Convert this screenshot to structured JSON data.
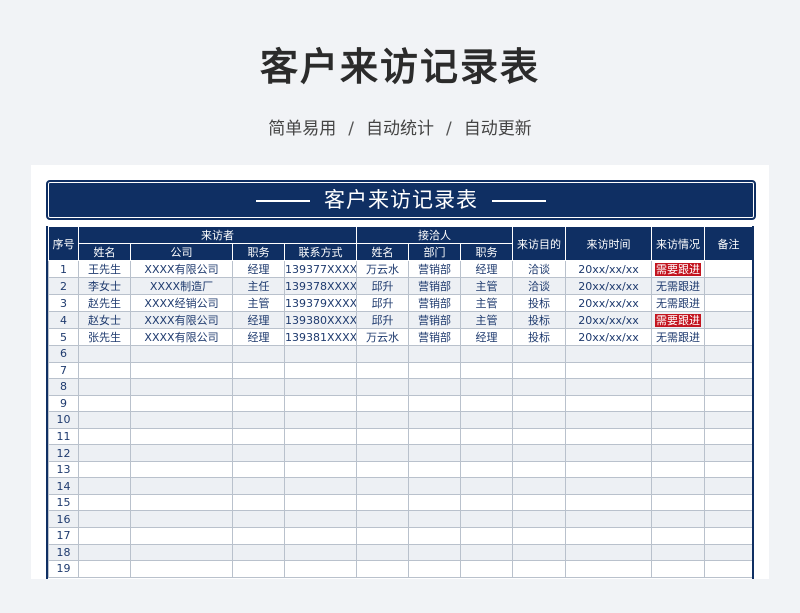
{
  "page_title": "客户来访记录表",
  "subtitle": [
    "简单易用",
    "自动统计",
    "自动更新"
  ],
  "subtitle_separator": "/",
  "banner_title": "客户来访记录表",
  "header": {
    "index": "序号",
    "visitor_group": "来访者",
    "host_group": "接洽人",
    "purpose": "来访目的",
    "time": "来访时间",
    "status": "来访情况",
    "note": "备注",
    "visitor_cols": [
      "姓名",
      "公司",
      "职务",
      "联系方式"
    ],
    "host_cols": [
      "姓名",
      "部门",
      "职务"
    ]
  },
  "colors": {
    "navy": "#0f2f63",
    "needs_followup": "#c3141f"
  },
  "rows": [
    {
      "idx": "1",
      "name": "王先生",
      "company": "XXXX有限公司",
      "title": "经理",
      "phone": "139377XXXX",
      "host": "万云水",
      "dept": "营销部",
      "host_title": "经理",
      "purpose": "洽谈",
      "time": "20xx/xx/xx",
      "status": "需要跟进",
      "note": ""
    },
    {
      "idx": "2",
      "name": "李女士",
      "company": "XXXX制造厂",
      "title": "主任",
      "phone": "139378XXXX",
      "host": "邱升",
      "dept": "营销部",
      "host_title": "主管",
      "purpose": "洽谈",
      "time": "20xx/xx/xx",
      "status": "无需跟进",
      "note": ""
    },
    {
      "idx": "3",
      "name": "赵先生",
      "company": "XXXX经销公司",
      "title": "主管",
      "phone": "139379XXXX",
      "host": "邱升",
      "dept": "营销部",
      "host_title": "主管",
      "purpose": "投标",
      "time": "20xx/xx/xx",
      "status": "无需跟进",
      "note": ""
    },
    {
      "idx": "4",
      "name": "赵女士",
      "company": "XXXX有限公司",
      "title": "经理",
      "phone": "139380XXXX",
      "host": "邱升",
      "dept": "营销部",
      "host_title": "主管",
      "purpose": "投标",
      "time": "20xx/xx/xx",
      "status": "需要跟进",
      "note": ""
    },
    {
      "idx": "5",
      "name": "张先生",
      "company": "XXXX有限公司",
      "title": "经理",
      "phone": "139381XXXX",
      "host": "万云水",
      "dept": "营销部",
      "host_title": "经理",
      "purpose": "投标",
      "time": "20xx/xx/xx",
      "status": "无需跟进",
      "note": ""
    },
    {
      "idx": "6"
    },
    {
      "idx": "7"
    },
    {
      "idx": "8"
    },
    {
      "idx": "9"
    },
    {
      "idx": "10"
    },
    {
      "idx": "11"
    },
    {
      "idx": "12"
    },
    {
      "idx": "13"
    },
    {
      "idx": "14"
    },
    {
      "idx": "15"
    },
    {
      "idx": "16"
    },
    {
      "idx": "17"
    },
    {
      "idx": "18"
    },
    {
      "idx": "19"
    }
  ],
  "status_needs_followup": "需要跟进"
}
